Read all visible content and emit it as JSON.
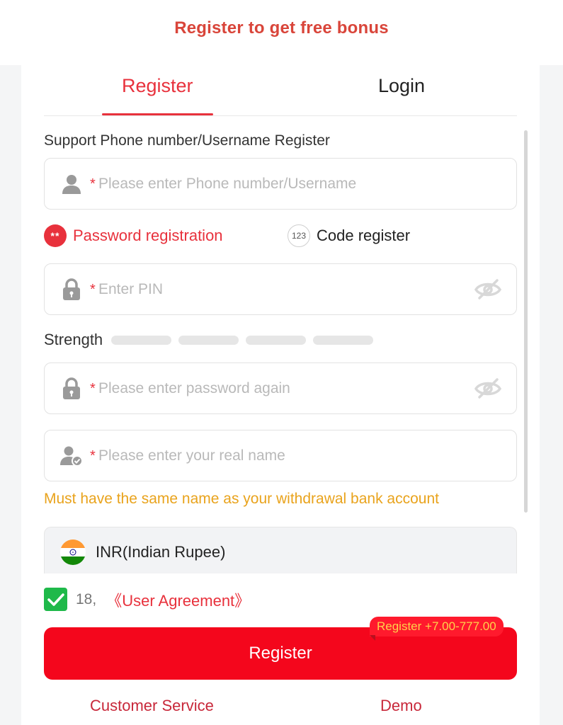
{
  "header": {
    "title": "Register to get free bonus"
  },
  "tabs": [
    {
      "label": "Register",
      "active": true
    },
    {
      "label": "Login",
      "active": false
    }
  ],
  "form": {
    "support_label": "Support Phone number/Username Register",
    "required_mark": "*",
    "username": {
      "placeholder": "Please enter Phone number/Username",
      "icon": "user-icon"
    },
    "modes": {
      "password": {
        "badge": "**",
        "label": "Password registration",
        "selected": true
      },
      "code": {
        "badge": "123",
        "label": "Code register",
        "selected": false
      }
    },
    "pin": {
      "placeholder": "Enter PIN",
      "icon": "lock-icon",
      "toggle_icon": "eye-off-icon"
    },
    "strength": {
      "label": "Strength",
      "segments": 4,
      "level": 0
    },
    "confirm": {
      "placeholder": "Please enter password again",
      "icon": "lock-icon",
      "toggle_icon": "eye-off-icon"
    },
    "real_name": {
      "placeholder": "Please enter your real name",
      "icon": "verified-user-icon"
    },
    "name_warning": "Must have the same name as your withdrawal bank account",
    "currency": {
      "label": "INR(Indian Rupee)",
      "icon": "india-flag-icon"
    },
    "agreement": {
      "checked": true,
      "age": "18,",
      "link": "《User Agreement》"
    },
    "submit": {
      "label": "Register",
      "bonus": "Register +7.00-777.00"
    }
  },
  "footer": {
    "customer_service": "Customer Service",
    "demo": "Demo"
  },
  "colors": {
    "accent": "#e8313c",
    "button": "#f4061c",
    "warning": "#e9a31c",
    "check": "#1fb94a",
    "bonus_text": "#ffd24a"
  }
}
